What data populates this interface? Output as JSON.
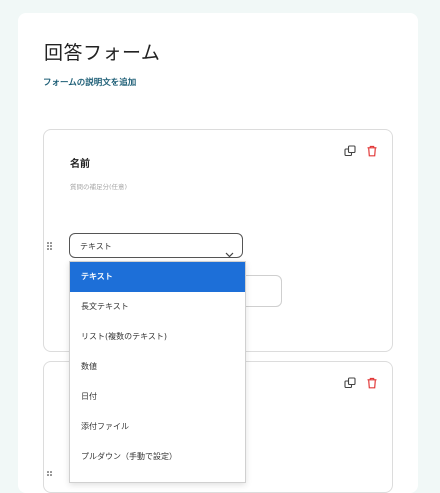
{
  "form": {
    "title": "回答フォーム",
    "description_link": "フォームの説明文を追加"
  },
  "question1": {
    "title": "名前",
    "help_placeholder": "質問の補足分(任意)",
    "type_select": {
      "value": "テキスト"
    }
  },
  "dropdown": {
    "options": [
      "テキスト",
      "長文テキスト",
      "リスト(複数のテキスト)",
      "数値",
      "日付",
      "添付ファイル",
      "プルダウン（手動で設定）"
    ],
    "selected_index": 0
  },
  "colors": {
    "page_bg": "#f1f8f7",
    "link": "#1d5e76",
    "selected_bg": "#1d6fd8",
    "delete_icon": "#e23a3a"
  },
  "icons": {
    "copy": "copy-icon",
    "delete": "trash-icon",
    "drag": "drag-handle-icon",
    "chevron": "chevron-down-icon"
  }
}
